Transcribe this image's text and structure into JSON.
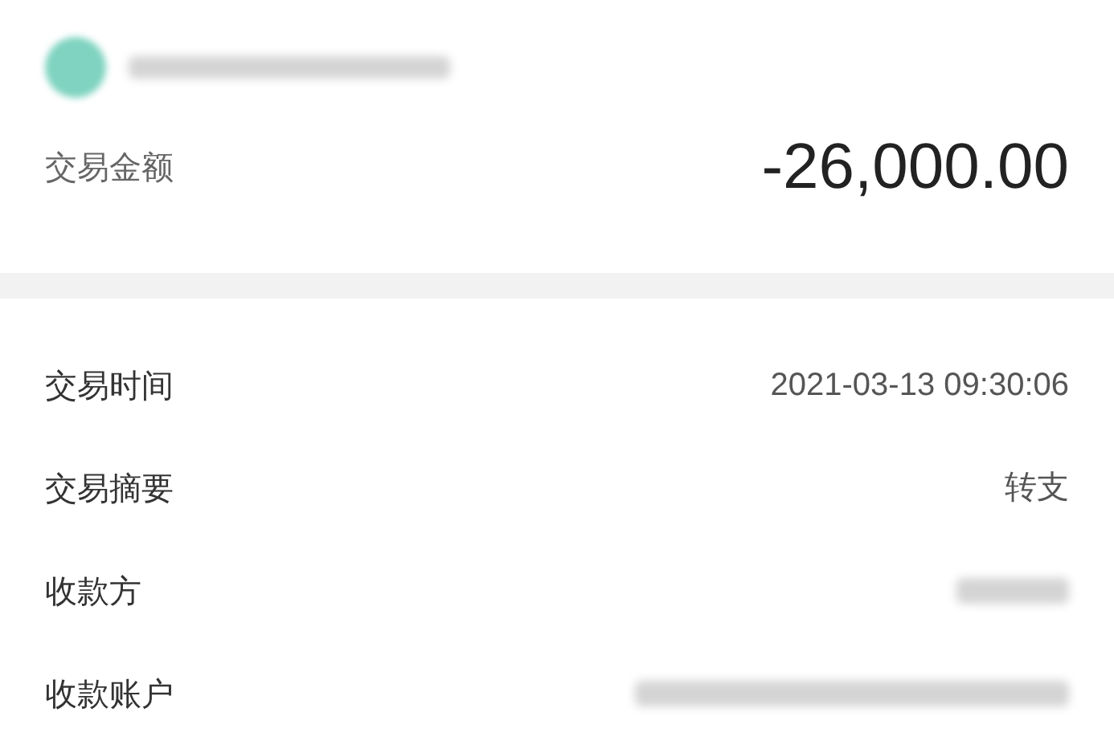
{
  "header": {
    "amount_label": "交易金额",
    "amount": "-26,000.00"
  },
  "details": [
    {
      "kind": "text",
      "label": "交易时间",
      "value": "2021-03-13 09:30:06"
    },
    {
      "kind": "text",
      "label": "交易摘要",
      "value": "转支"
    },
    {
      "kind": "redacted",
      "label": "收款方"
    },
    {
      "kind": "redacted",
      "label": "收款账户"
    }
  ]
}
